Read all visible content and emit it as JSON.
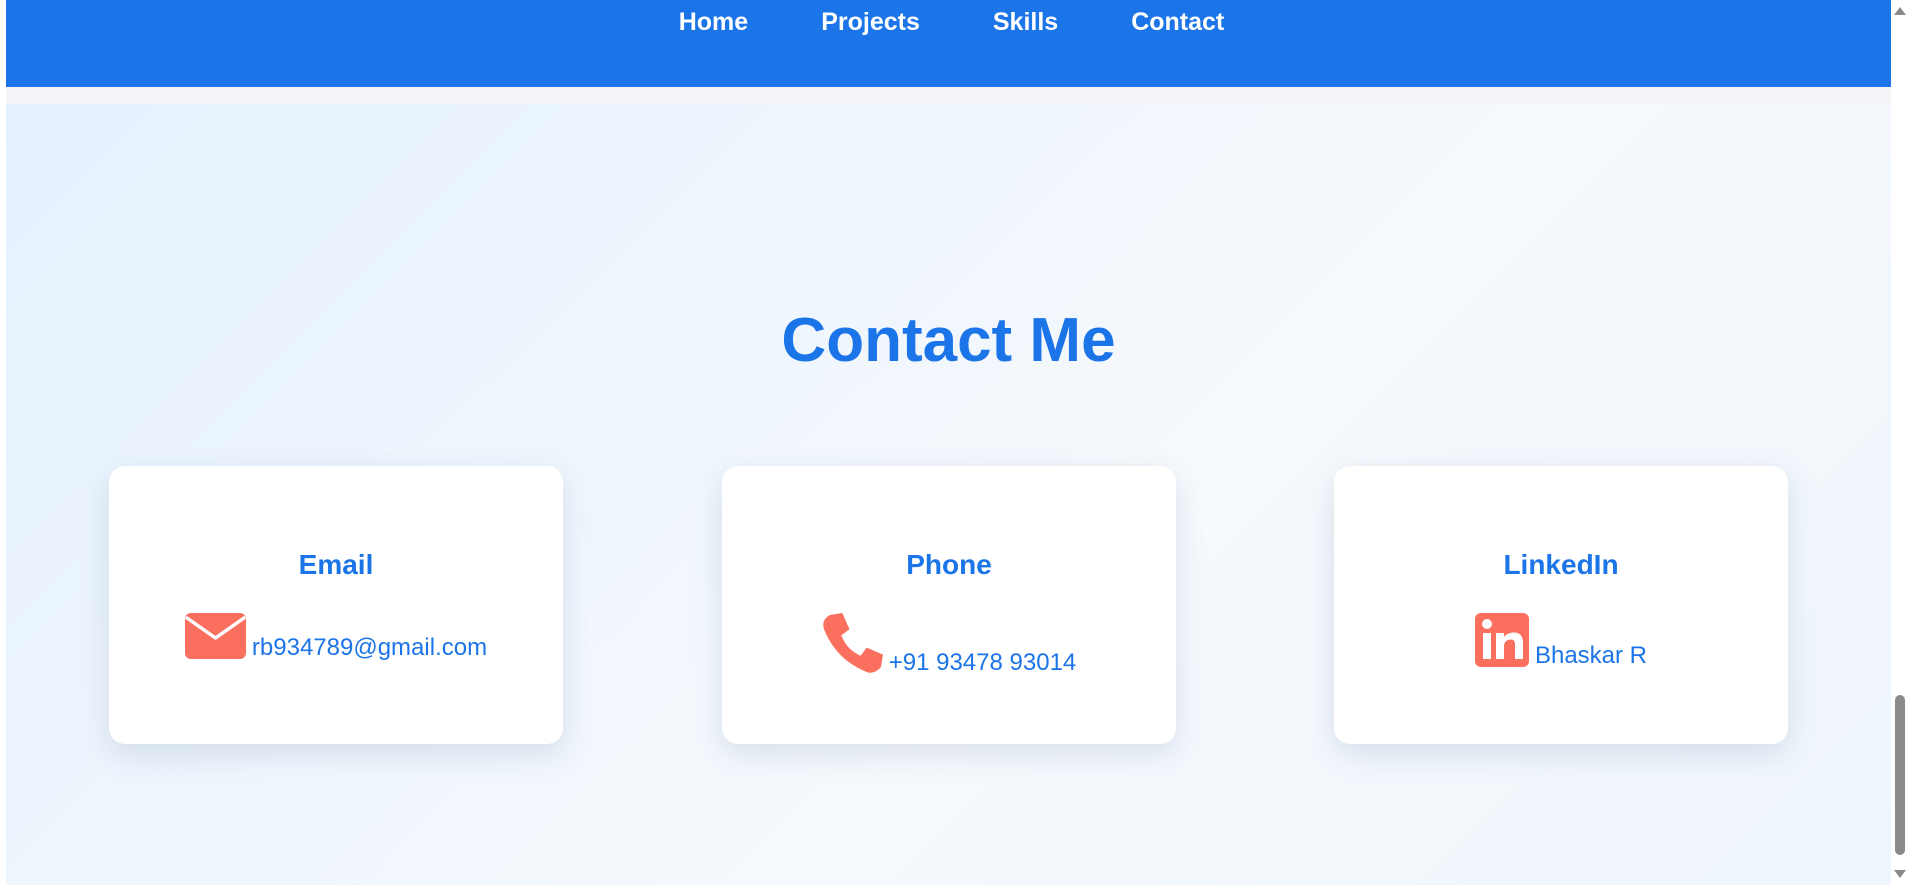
{
  "nav": {
    "items": [
      {
        "label": "Home"
      },
      {
        "label": "Projects"
      },
      {
        "label": "Skills"
      },
      {
        "label": "Contact"
      }
    ]
  },
  "contact": {
    "title": "Contact Me",
    "cards": [
      {
        "title": "Email",
        "value": "rb934789@gmail.com",
        "icon": "envelope-icon"
      },
      {
        "title": "Phone",
        "value": "+91 93478 93014",
        "icon": "phone-icon"
      },
      {
        "title": "LinkedIn",
        "value": "Bhaskar R",
        "icon": "linkedin-icon"
      }
    ]
  },
  "colors": {
    "primary": "#1b74e8",
    "icon_accent": "#fa6f5e",
    "card_bg": "#ffffff"
  }
}
